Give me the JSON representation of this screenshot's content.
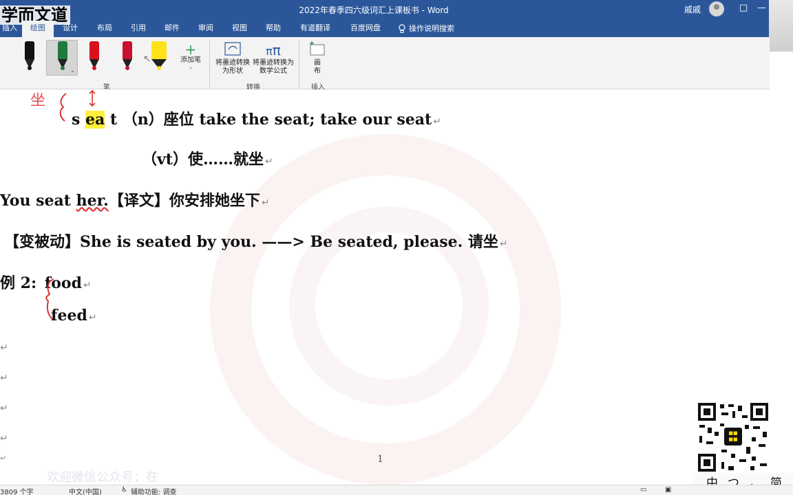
{
  "window": {
    "logo": "学而文道",
    "title": "2022年春季四六级词汇上课板书  -  Word",
    "user": "戚戚",
    "restore_glyph": "□",
    "minimize_glyph": "—"
  },
  "tabs": [
    {
      "label": "插入"
    },
    {
      "label": "绘图",
      "active": true
    },
    {
      "label": "设计"
    },
    {
      "label": "布局"
    },
    {
      "label": "引用"
    },
    {
      "label": "邮件"
    },
    {
      "label": "审阅"
    },
    {
      "label": "视图"
    },
    {
      "label": "帮助"
    },
    {
      "label": "有道翻译"
    },
    {
      "label": "百度网盘"
    },
    {
      "label": "操作说明搜索"
    }
  ],
  "ribbon": {
    "pens": [
      {
        "name": "black-pen",
        "color": "#111111"
      },
      {
        "name": "green-pen",
        "color": "#1f7a3c"
      },
      {
        "name": "red-pen",
        "color": "#d8111c"
      },
      {
        "name": "red-galaxy-pen",
        "color": "#c8102e"
      },
      {
        "name": "yellow-highlighter",
        "color": "#ffe21a"
      }
    ],
    "add_pen_label": "添加笔 -",
    "pen_group_label": "笔",
    "ink_to_shape_label": "将墨迹转换为形状",
    "ink_to_math_label": "将墨迹转换为数学公式",
    "convert_group_label": "转换",
    "canvas_label": "画布",
    "insert_group_label": "插入"
  },
  "document": {
    "annotation": "坐",
    "line1": {
      "pre": "s ",
      "highlight": "ea",
      "post": " t  （n）座位  take the seat; take our seat"
    },
    "line2": "（vt）使……就坐",
    "line3": {
      "pre": "You seat ",
      "underline": "her.",
      "post": "【译文】你安排她坐下"
    },
    "line4": "【变被动】She is seated by you.  ——> Be seated, please.  请坐",
    "line5": {
      "label": "例 2:",
      "word": "food"
    },
    "line6": "feed",
    "para_mark": "↵",
    "page_number": "1"
  },
  "overlay": {
    "faded_text": "欢迎微信公众号：在",
    "ime": [
      "中",
      "つ",
      "，",
      "简"
    ]
  },
  "statusbar": {
    "word_count": "3809 个字",
    "language": "中文(中国)",
    "accessibility": "辅助功能: 调查"
  }
}
